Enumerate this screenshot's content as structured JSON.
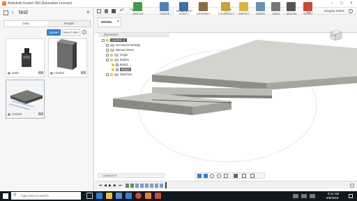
{
  "app": {
    "title": "Autodesk Fusion 360 (Education License)",
    "user": "Gregory James",
    "doc_tab": "Untitled v1*",
    "win_min": "−",
    "win_max": "□",
    "win_close": "×"
  },
  "data_panel": {
    "title": "test",
    "tabs": [
      "Data",
      "People"
    ],
    "upload_label": "Upload",
    "new_folder_label": "New Folder",
    "items": [
      {
        "name": "Bottle",
        "version": "V1"
      },
      {
        "name": "Untitled",
        "version": "V1"
      },
      {
        "name": "Untitled",
        "version": "V1"
      }
    ]
  },
  "toolbar": {
    "workspace": "MODEL",
    "groups": [
      "SKETCH",
      "CREATE",
      "MODIFY",
      "ASSEMBLE",
      "CONSTRUCT",
      "INSPECT",
      "INSERT",
      "MAKE",
      "ADD-INS",
      "SELECT"
    ]
  },
  "browser": {
    "header": "BROWSER",
    "root": "Untitled v1",
    "nodes": [
      "Document Settings",
      "Named Views",
      "Origin",
      "Bodies",
      "Body1",
      "Body2",
      "Sketches"
    ]
  },
  "viewcube": {
    "face": "FRONT"
  },
  "comments": {
    "label": "COMMENTS"
  },
  "taskbar": {
    "search_placeholder": "Type here to search",
    "time": "8:11 AM",
    "date": "5/5/2018"
  },
  "colors": {
    "accent": "#2d7fd3",
    "body_top": "#d4d4ce",
    "body_side": "#8e8e88",
    "taskbar": "#101820"
  }
}
